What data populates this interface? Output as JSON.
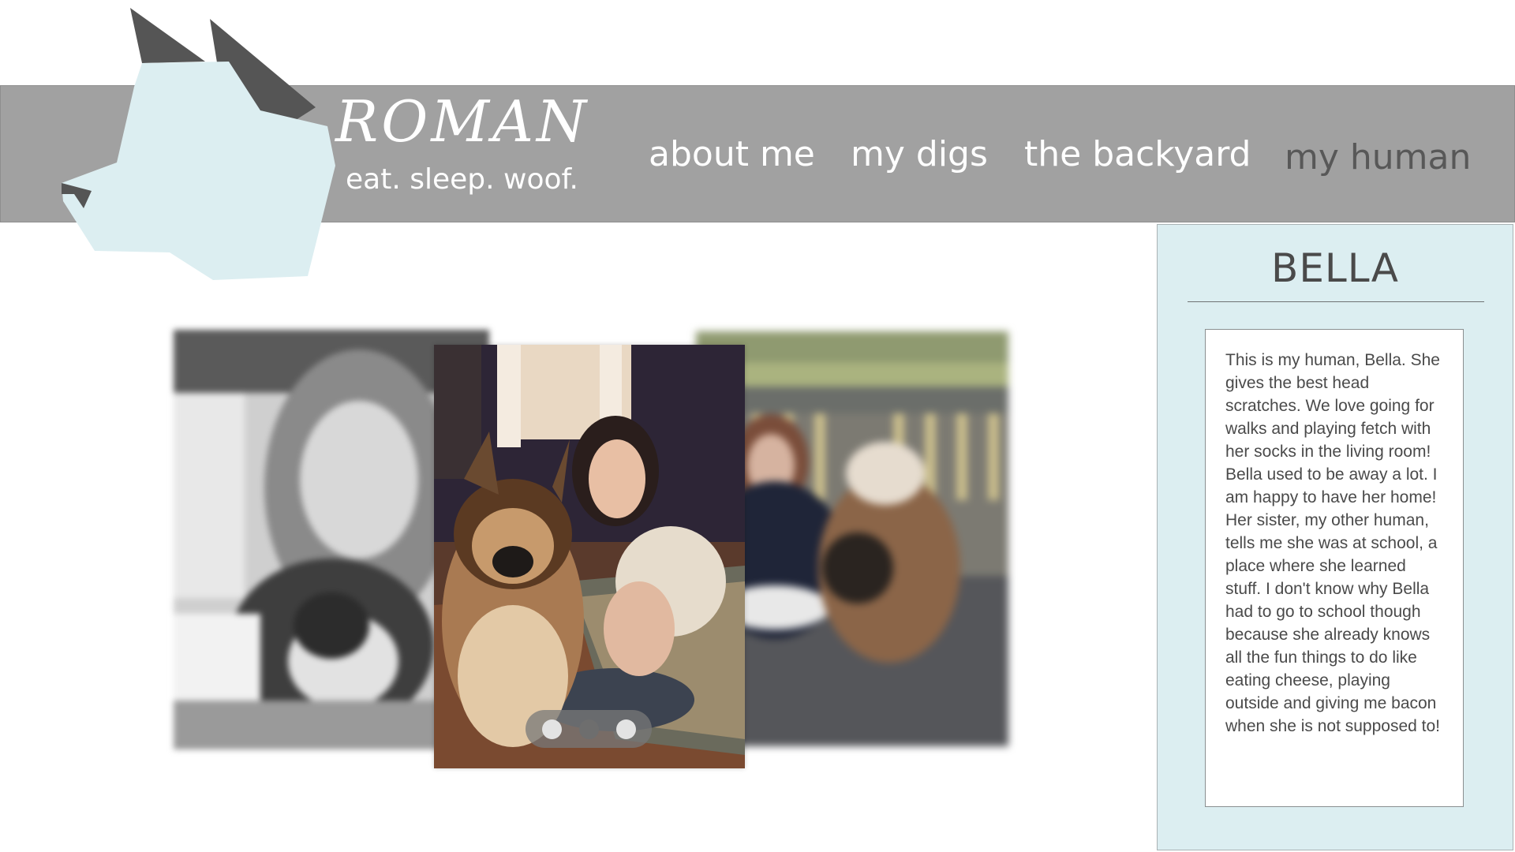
{
  "header": {
    "brand_title": "ROMAN",
    "tagline": "eat. sleep. woof.",
    "nav": [
      {
        "label": "about me",
        "active": false
      },
      {
        "label": "my digs",
        "active": false
      },
      {
        "label": "the backyard",
        "active": false
      },
      {
        "label": "my human",
        "active": true
      }
    ]
  },
  "gallery": {
    "photos": [
      "person-hugging-dog",
      "person-with-dog-indoors",
      "person-with-dog-on-deck"
    ],
    "dots": [
      {
        "active": false
      },
      {
        "active": true
      },
      {
        "active": false
      }
    ]
  },
  "profile": {
    "name": "BELLA",
    "description": "This is my human, Bella. She gives the best head scratches. We love going for walks and playing fetch with her socks in the living room! Bella used to be away a lot. I am happy to have her home! Her sister, my other human, tells me she was at school, a place where she learned stuff. I don't know why Bella had to go to school though because she already knows all the fun things to do like eating cheese, playing outside and giving me bacon when she is not supposed to!"
  },
  "colors": {
    "header_bar": "#a1a1a1",
    "logo_face": "#dceef1",
    "logo_ears": "#555555",
    "panel_bg": "#dceef1",
    "active_nav": "#585858"
  }
}
